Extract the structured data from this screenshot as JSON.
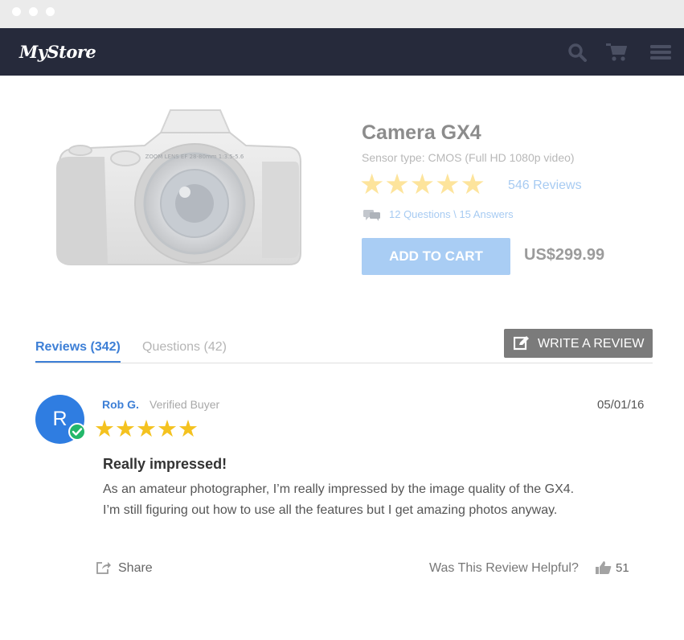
{
  "navbar": {
    "logo": "MyStore",
    "icons": [
      "search-icon",
      "cart-icon",
      "menu-icon"
    ]
  },
  "product": {
    "name": "Camera GX4",
    "sensor": "Sensor type: CMOS (Full HD 1080p video)",
    "rating_stars": "★★★★★",
    "rating": 5,
    "reviews_link": "546 Reviews",
    "qa_link": "12 Questions \\ 15 Answers",
    "add_to_cart": "ADD TO CART",
    "price": "US$299.99",
    "lens_text": "ZOOM LENS EF 28-80mm 1:3.5-5.6"
  },
  "tabs": {
    "reviews": "Reviews (342)",
    "questions": "Questions (42)",
    "write_review": "WRITE A REVIEW"
  },
  "review": {
    "avatar_letter": "R",
    "name": "Rob G.",
    "status": "Verified Buyer",
    "date": "05/01/16",
    "stars": "★★★★★",
    "rating": 5,
    "title": "Really impressed!",
    "body_line1": "As an amateur photographer, I’m really impressed by the image quality of the GX4.",
    "body_line2": "I’m still figuring out how to use all the features but I get amazing photos anyway.",
    "share": "Share",
    "helpful_question": "Was This Review Helpful?",
    "helpful_count": "51"
  },
  "colors": {
    "navbar": "#262a3b",
    "accent_blue": "#3d7fd6",
    "add_to_cart": "#a9cdf4",
    "star_gold": "#f4c21f",
    "verified_green": "#23b76a"
  }
}
